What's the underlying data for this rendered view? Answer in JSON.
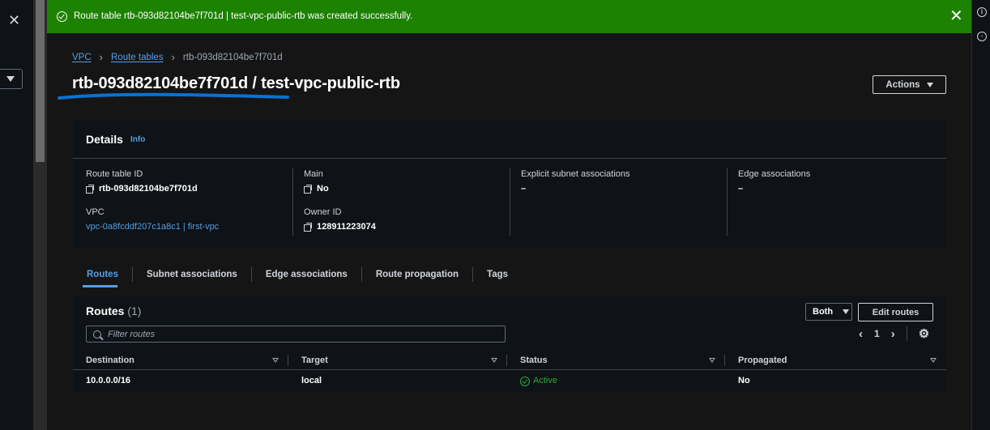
{
  "flash": {
    "message": "Route table rtb-093d82104be7f701d | test-vpc-public-rtb was created successfully.",
    "icon": "check-circle-icon",
    "color": "#1d8102"
  },
  "breadcrumb": {
    "vpc": "VPC",
    "route_tables": "Route tables",
    "current": "rtb-093d82104be7f701d"
  },
  "page": {
    "title_id": "rtb-093d82104be7f701d",
    "title_sep": " / ",
    "title_name": "test-vpc-public-rtb",
    "actions_label": "Actions"
  },
  "details": {
    "title": "Details",
    "info": "Info",
    "route_table_id_label": "Route table ID",
    "route_table_id": "rtb-093d82104be7f701d",
    "vpc_label": "VPC",
    "vpc_value": "vpc-0a8fcddf207c1a8c1 | first-vpc",
    "main_label": "Main",
    "main_value": "No",
    "owner_label": "Owner ID",
    "owner_value": "128911223074",
    "explicit_label": "Explicit subnet associations",
    "explicit_value": "–",
    "edge_label": "Edge associations",
    "edge_value": "–"
  },
  "tabs": [
    {
      "label": "Routes",
      "active": true
    },
    {
      "label": "Subnet associations",
      "active": false
    },
    {
      "label": "Edge associations",
      "active": false
    },
    {
      "label": "Route propagation",
      "active": false
    },
    {
      "label": "Tags",
      "active": false
    }
  ],
  "routes": {
    "title": "Routes",
    "count": "(1)",
    "filter_select": "Both",
    "edit_label": "Edit routes",
    "filter_placeholder": "Filter routes",
    "page": "1",
    "columns": [
      "Destination",
      "Target",
      "Status",
      "Propagated"
    ],
    "rows": [
      {
        "destination": "10.0.0.0/16",
        "target": "local",
        "status": "Active",
        "propagated": "No"
      }
    ]
  },
  "colors": {
    "accent": "#539fe5",
    "success": "#29ad32",
    "annotation": "#0972d3"
  }
}
